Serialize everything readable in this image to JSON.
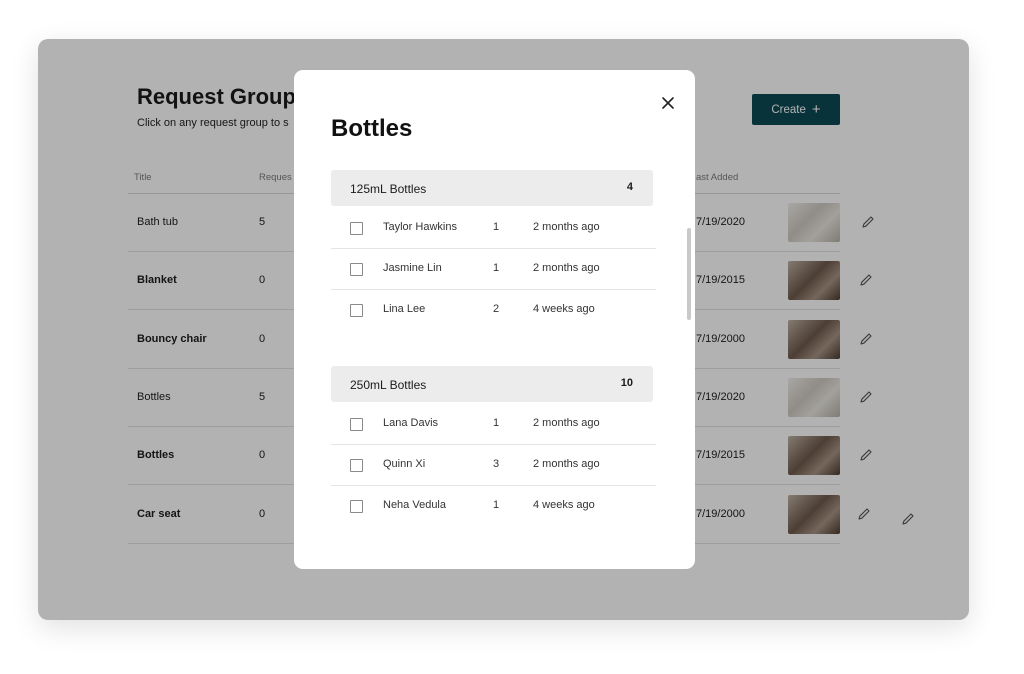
{
  "page": {
    "title": "Request Groups",
    "subtitle": "Click on any request group to s",
    "create_label": "Create"
  },
  "table": {
    "headers": {
      "title": "Title",
      "requests": "Reques",
      "last_added": "ast Added"
    },
    "rows": [
      {
        "title": "Bath tub",
        "requests": "5",
        "date": "7/19/2020",
        "thumb_tone": "light"
      },
      {
        "title": "Blanket",
        "requests": "0",
        "date": "7/19/2015",
        "thumb_tone": "dark"
      },
      {
        "title": "Bouncy chair",
        "requests": "0",
        "date": "7/19/2000",
        "thumb_tone": "dark"
      },
      {
        "title": "Bottles",
        "requests": "5",
        "date": "7/19/2020",
        "thumb_tone": "light"
      },
      {
        "title": "Bottles",
        "requests": "0",
        "date": "7/19/2015",
        "thumb_tone": "dark"
      },
      {
        "title": "Car seat",
        "requests": "0",
        "date": "7/19/2000",
        "thumb_tone": "dark"
      }
    ]
  },
  "modal": {
    "title": "Bottles",
    "groups": [
      {
        "name": "125mL Bottles",
        "count": "4",
        "requests": [
          {
            "name": "Taylor Hawkins",
            "qty": "1",
            "time": "2 months ago"
          },
          {
            "name": "Jasmine Lin",
            "qty": "1",
            "time": "2 months ago"
          },
          {
            "name": "Lina Lee",
            "qty": "2",
            "time": "4 weeks ago"
          }
        ]
      },
      {
        "name": "250mL Bottles",
        "count": "10",
        "requests": [
          {
            "name": "Lana Davis",
            "qty": "1",
            "time": "2 months ago"
          },
          {
            "name": "Quinn Xi",
            "qty": "3",
            "time": "2 months ago"
          },
          {
            "name": "Neha Vedula",
            "qty": "1",
            "time": "4 weeks ago"
          }
        ]
      }
    ]
  },
  "colors": {
    "accent": "#0d4a55",
    "overlay": "#000000",
    "group_header_bg": "#ececec"
  },
  "icons": {
    "close": "close-icon",
    "edit": "pencil-icon",
    "create": "plus-icon"
  }
}
